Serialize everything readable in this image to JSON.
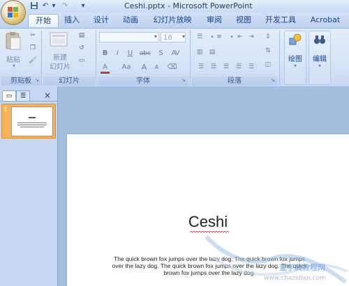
{
  "window": {
    "title": "Ceshi.pptx - Microsoft PowerPoint"
  },
  "quick_access": {
    "save_icon": "save-icon",
    "undo_icon": "undo-icon",
    "redo_icon": "redo-icon",
    "customize_icon": "customize-qat-icon"
  },
  "tabs": [
    {
      "label": "开始",
      "active": true
    },
    {
      "label": "插入"
    },
    {
      "label": "设计"
    },
    {
      "label": "动画"
    },
    {
      "label": "幻灯片放映"
    },
    {
      "label": "审阅"
    },
    {
      "label": "视图"
    },
    {
      "label": "开发工具"
    },
    {
      "label": "Acrobat"
    }
  ],
  "ribbon": {
    "clipboard": {
      "paste_label": "粘贴",
      "group_label": "剪贴板"
    },
    "slides": {
      "new_slide_line1": "新建",
      "new_slide_line2": "幻灯片",
      "group_label": "幻灯片"
    },
    "font": {
      "font_name": "",
      "font_size": "18",
      "bold": "B",
      "italic": "I",
      "underline": "U",
      "strike": "abc",
      "shadow": "S",
      "case": "Aa",
      "grow": "A",
      "shrink": "A",
      "group_label": "字体"
    },
    "paragraph": {
      "group_label": "段落"
    },
    "drawing": {
      "label": "绘图"
    },
    "editing": {
      "label": "编辑"
    }
  },
  "panel": {
    "slide_number": "1",
    "close": "×"
  },
  "slide": {
    "title": "Ceshi",
    "body": "The quick brown fox jumps over the lazy dog. The quick brown fox jumps over the lazy dog. The quick brown fox jumps over the lazy dog. The quick brown fox jumps over the lazy dog."
  },
  "watermark": {
    "text": "查字典教程网",
    "url": "www.chazidian.com"
  },
  "colors": {
    "accent": "#15428b",
    "ribbon_bg": "#dbe7f7",
    "workspace": "#a4bedf",
    "thumb_highlight": "#f8b35a"
  }
}
